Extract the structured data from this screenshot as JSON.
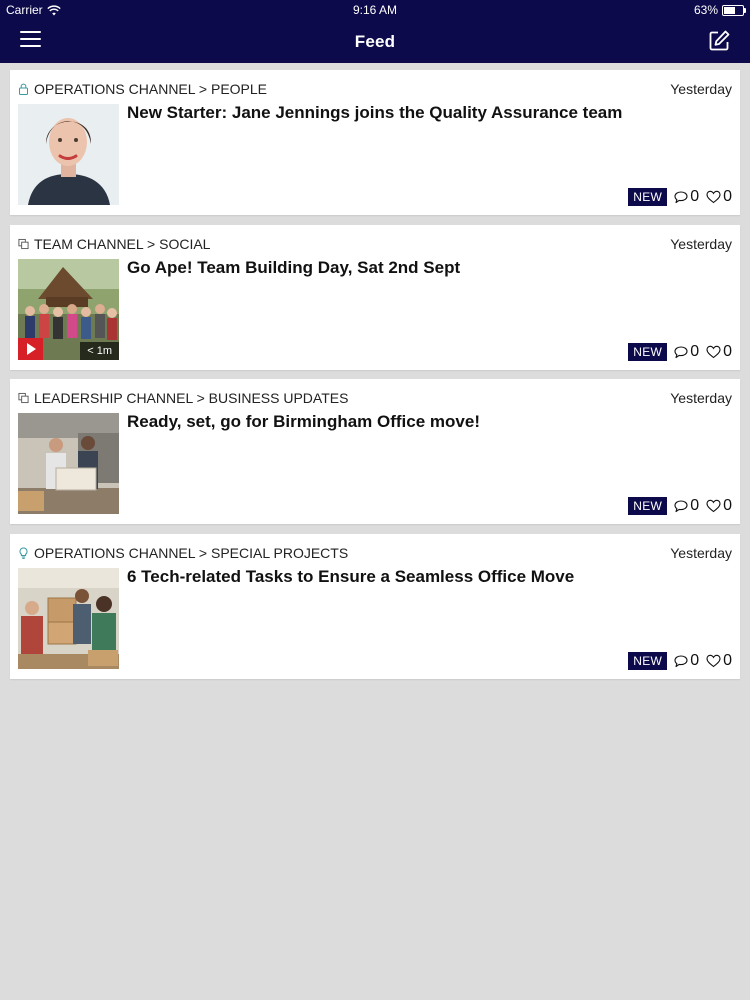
{
  "status_bar": {
    "carrier": "Carrier",
    "time": "9:16 AM",
    "battery": "63%",
    "battery_level": 0.63,
    "icons": [
      "wifi-icon",
      "battery-icon"
    ]
  },
  "nav": {
    "title": "Feed",
    "left_icon": "hamburger-menu-icon",
    "right_icon": "compose-icon"
  },
  "colors": {
    "nav_background": "#0c0a4a",
    "new_badge": "#0c0a4a",
    "page_background": "#dcdcdc",
    "play_button": "#d61f26"
  },
  "feed": [
    {
      "channel": "OPERATIONS CHANNEL > PEOPLE",
      "channel_icon": "lock-icon",
      "date": "Yesterday",
      "title": "New Starter: Jane Jennings joins the Quality Assurance team",
      "badge": "NEW",
      "comments": "0",
      "likes": "0",
      "thumbnail": "portrait-photo",
      "video": false
    },
    {
      "channel": "TEAM CHANNEL > SOCIAL",
      "channel_icon": "copy-icon",
      "date": "Yesterday",
      "title": "Go Ape! Team Building Day, Sat 2nd Sept",
      "badge": "NEW",
      "comments": "0",
      "likes": "0",
      "thumbnail": "group-photo",
      "video": true,
      "duration": "< 1m"
    },
    {
      "channel": "LEADERSHIP CHANNEL > BUSINESS UPDATES",
      "channel_icon": "copy-icon",
      "date": "Yesterday",
      "title": "Ready, set, go for Birmingham Office move!",
      "badge": "NEW",
      "comments": "0",
      "likes": "0",
      "thumbnail": "office-move-photo",
      "video": false
    },
    {
      "channel": "OPERATIONS CHANNEL > SPECIAL PROJECTS",
      "channel_icon": "lightbulb-icon",
      "date": "Yesterday",
      "title": "6 Tech-related Tasks to Ensure a Seamless Office Move",
      "badge": "NEW",
      "comments": "0",
      "likes": "0",
      "thumbnail": "team-photo",
      "video": false
    }
  ]
}
